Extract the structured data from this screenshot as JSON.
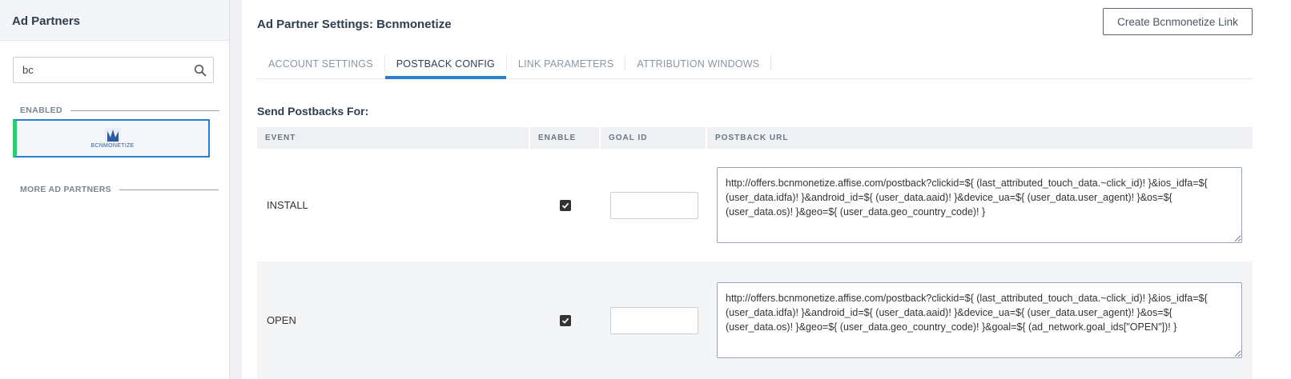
{
  "sidebar": {
    "title": "Ad Partners",
    "search": {
      "value": "bc"
    },
    "enabled_label": "ENABLED",
    "more_label": "MORE AD PARTNERS",
    "partners": [
      {
        "logo_text": "BCNMONETIZE"
      }
    ]
  },
  "main": {
    "title": "Ad Partner Settings: Bcnmonetize",
    "create_button": "Create Bcnmonetize Link",
    "tabs": [
      {
        "label": "ACCOUNT SETTINGS",
        "active": false
      },
      {
        "label": "POSTBACK CONFIG",
        "active": true
      },
      {
        "label": "LINK PARAMETERS",
        "active": false
      },
      {
        "label": "ATTRIBUTION WINDOWS",
        "active": false
      }
    ],
    "section_title": "Send Postbacks For:",
    "columns": [
      "EVENT",
      "ENABLE",
      "GOAL ID",
      "POSTBACK URL"
    ],
    "rows": [
      {
        "event": "INSTALL",
        "enabled": true,
        "goal_id": "",
        "postback_url": "http://offers.bcnmonetize.affise.com/postback?clickid=${ (last_attributed_touch_data.~click_id)! }&ios_idfa=${ (user_data.idfa)! }&android_id=${ (user_data.aaid)! }&device_ua=${ (user_data.user_agent)! }&os=${ (user_data.os)! }&geo=${ (user_data.geo_country_code)! }"
      },
      {
        "event": "OPEN",
        "enabled": true,
        "goal_id": "",
        "postback_url": "http://offers.bcnmonetize.affise.com/postback?clickid=${ (last_attributed_touch_data.~click_id)! }&ios_idfa=${ (user_data.idfa)! }&android_id=${ (user_data.aaid)! }&device_ua=${ (user_data.user_agent)! }&os=${ (user_data.os)! }&geo=${ (user_data.geo_country_code)! }&goal=${ (ad_network.goal_ids[\"OPEN\"])! }"
      }
    ]
  },
  "colors": {
    "accent": "#2b7fd0",
    "enabled_marker": "#2ecc71"
  }
}
